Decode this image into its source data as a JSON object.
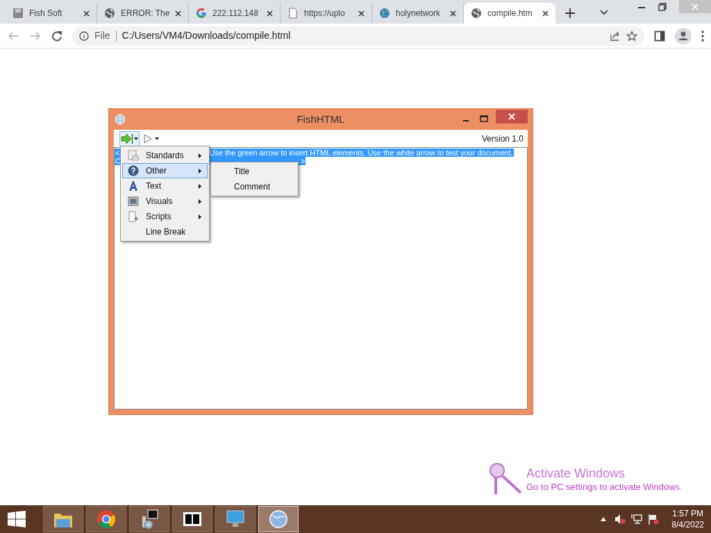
{
  "browser": {
    "tabs": [
      {
        "title": "Fish Soft",
        "kind": "app",
        "selected": false
      },
      {
        "title": "ERROR: The",
        "kind": "globe",
        "selected": false
      },
      {
        "title": "222.112.148",
        "kind": "google",
        "selected": false
      },
      {
        "title": "https://uplo",
        "kind": "page",
        "selected": false
      },
      {
        "title": "holynetwork",
        "kind": "earth",
        "selected": false
      },
      {
        "title": "compile.htm",
        "kind": "globe",
        "selected": true
      }
    ],
    "address": {
      "scheme": "File",
      "url": "C:/Users/VM4/Downloads/compile.html"
    }
  },
  "app": {
    "title": "FishHTML",
    "version": "Version 1.0",
    "editor_lines": [
      [
        "<",
        "Use the green arrow to insert HTML elements. Use the white arrow to test your document."
      ],
      [
        "C",
        ">"
      ]
    ],
    "menu": [
      {
        "label": "Standards",
        "kind": "standards",
        "submenu": true,
        "selected": false
      },
      {
        "label": "Other",
        "kind": "help",
        "submenu": true,
        "selected": true
      },
      {
        "label": "Text",
        "kind": "text",
        "submenu": true,
        "selected": false
      },
      {
        "label": "Visuals",
        "kind": "image",
        "submenu": true,
        "selected": false
      },
      {
        "label": "Scripts",
        "kind": "script",
        "submenu": true,
        "selected": false
      },
      {
        "label": "Line Break",
        "kind": "none",
        "submenu": false,
        "selected": false
      }
    ],
    "submenu": [
      "Title",
      "Comment"
    ]
  },
  "watermark": {
    "title": "Activate Windows",
    "subtitle": "Go to PC settings to activate Windows."
  },
  "taskbar": {
    "apps": [
      {
        "kind": "folder",
        "selected": false
      },
      {
        "kind": "chrome",
        "selected": false
      },
      {
        "kind": "installer",
        "selected": false
      },
      {
        "kind": "sevenzip",
        "selected": false
      },
      {
        "kind": "monitor",
        "selected": false
      },
      {
        "kind": "globe",
        "selected": true
      }
    ],
    "time": "1:57 PM",
    "date": "8/4/2022"
  }
}
